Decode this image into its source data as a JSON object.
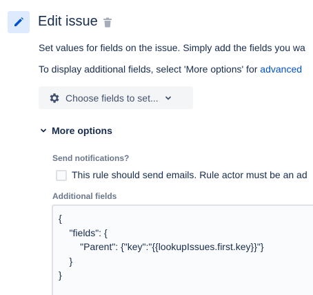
{
  "header": {
    "title": "Edit issue",
    "edit_icon": "pencil-icon",
    "delete_icon": "trash-icon"
  },
  "description": {
    "line1": "Set values for fields on the issue. Simply add the fields you wa",
    "line2_prefix": "To display additional fields, select 'More options' for ",
    "line2_link": "advanced"
  },
  "choose_fields": {
    "label": "Choose fields to set...",
    "icon": "gear-icon",
    "chevron": "chevron-down-icon"
  },
  "more_options": {
    "label": "More options",
    "expanded": true
  },
  "notifications": {
    "label": "Send notifications?",
    "checkbox_label": "This rule should send emails. Rule actor must be an ad",
    "checked": false
  },
  "additional_fields": {
    "label": "Additional fields",
    "lines": [
      "{",
      "    \"fields\": {",
      "        \"Parent\": {\"key\":\"{{lookupIssues.first.key}}\"}",
      "    }",
      "}"
    ]
  },
  "colors": {
    "accent_bg": "#deebff",
    "accent": "#0052cc",
    "text": "#172b4d",
    "subtle": "#6b778c",
    "button_bg": "#f4f5f7"
  }
}
